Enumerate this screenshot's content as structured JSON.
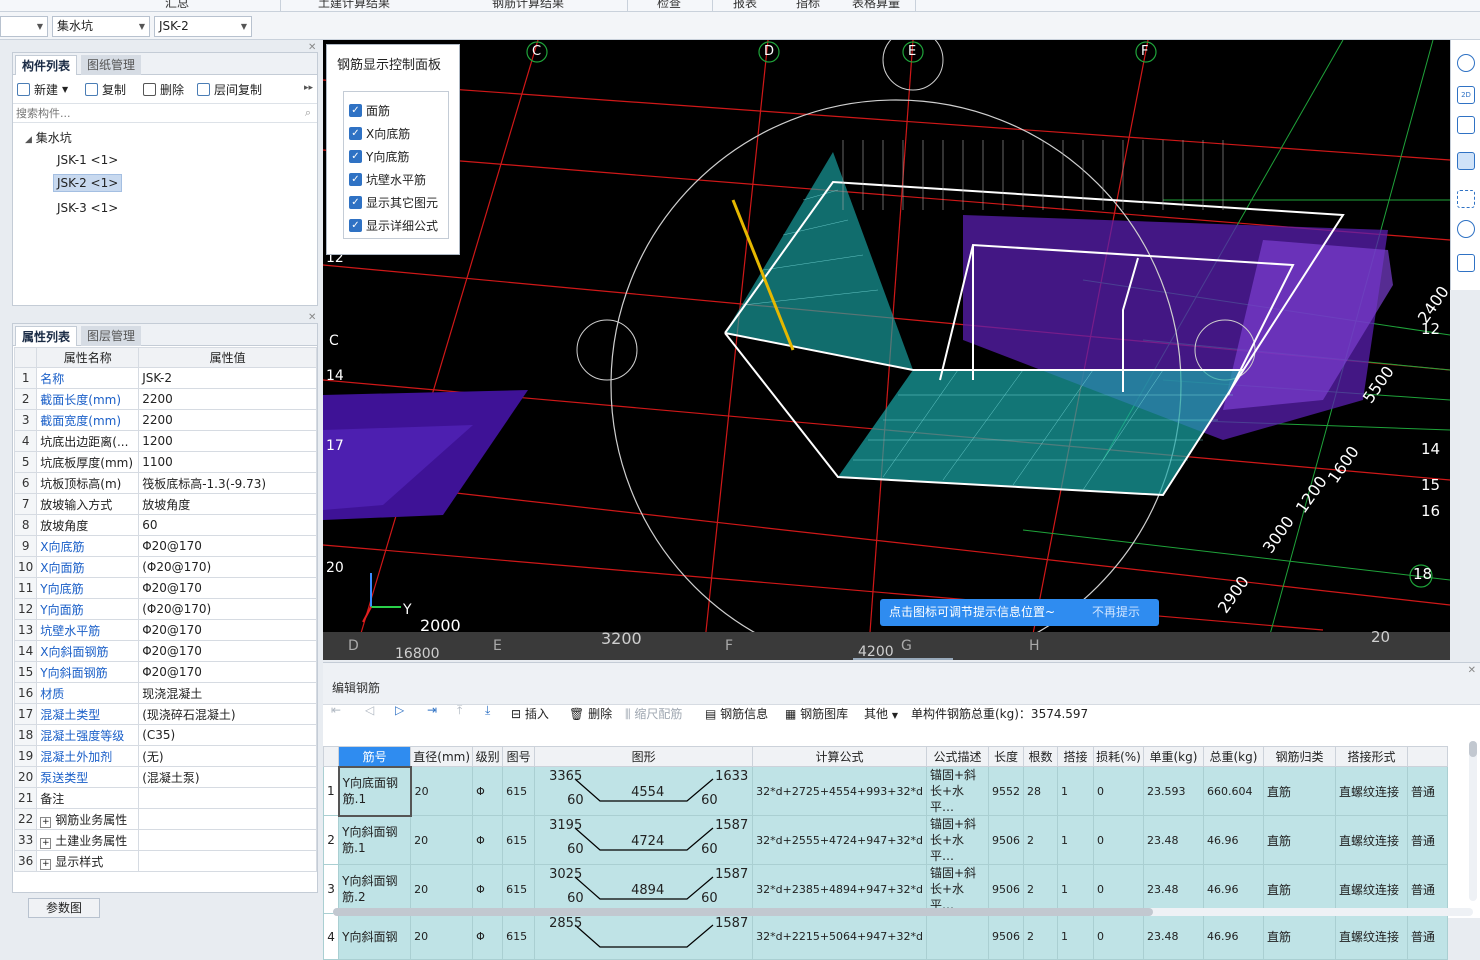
{
  "top_menu": [
    "汇总",
    "土建计算结果",
    "钢筋计算结果",
    "检查",
    "报表",
    "指标",
    "表格算量"
  ],
  "selectors": {
    "first": "",
    "category": "集水坑",
    "instance": "JSK-2"
  },
  "component_panel": {
    "tabs": [
      "构件列表",
      "图纸管理"
    ],
    "toolbar": [
      "新建",
      "复制",
      "删除",
      "层间复制"
    ],
    "search_placeholder": "搜索构件...",
    "root": "集水坑",
    "items": [
      "JSK-1 <1>",
      "JSK-2 <1>",
      "JSK-3 <1>"
    ]
  },
  "property_panel": {
    "tabs": [
      "属性列表",
      "图层管理"
    ],
    "header": [
      "属性名称",
      "属性值"
    ],
    "rows": [
      {
        "no": "1",
        "name": "名称",
        "value": "JSK-2",
        "blue": true
      },
      {
        "no": "2",
        "name": "截面长度(mm)",
        "value": "2200",
        "blue": true
      },
      {
        "no": "3",
        "name": "截面宽度(mm)",
        "value": "2200",
        "blue": true
      },
      {
        "no": "4",
        "name": "坑底出边距离(...",
        "value": "1200",
        "blue": false
      },
      {
        "no": "5",
        "name": "坑底板厚度(mm)",
        "value": "1100",
        "blue": false
      },
      {
        "no": "6",
        "name": "坑板顶标高(m)",
        "value": "筏板底标高-1.3(-9.73)",
        "blue": false
      },
      {
        "no": "7",
        "name": "放坡输入方式",
        "value": "放坡角度",
        "blue": false
      },
      {
        "no": "8",
        "name": "放坡角度",
        "value": "60",
        "blue": false
      },
      {
        "no": "9",
        "name": "X向底筋",
        "value": "Φ20@170",
        "blue": true
      },
      {
        "no": "10",
        "name": "X向面筋",
        "value": "(Φ20@170)",
        "blue": true
      },
      {
        "no": "11",
        "name": "Y向底筋",
        "value": "Φ20@170",
        "blue": true
      },
      {
        "no": "12",
        "name": "Y向面筋",
        "value": "(Φ20@170)",
        "blue": true
      },
      {
        "no": "13",
        "name": "坑壁水平筋",
        "value": "Φ20@170",
        "blue": true
      },
      {
        "no": "14",
        "name": "X向斜面钢筋",
        "value": "Φ20@170",
        "blue": true
      },
      {
        "no": "15",
        "name": "Y向斜面钢筋",
        "value": "Φ20@170",
        "blue": true
      },
      {
        "no": "16",
        "name": "材质",
        "value": "现浇混凝土",
        "blue": true
      },
      {
        "no": "17",
        "name": "混凝土类型",
        "value": "(现浇碎石混凝土)",
        "blue": true
      },
      {
        "no": "18",
        "name": "混凝土强度等级",
        "value": "(C35)",
        "blue": true
      },
      {
        "no": "19",
        "name": "混凝土外加剂",
        "value": "(无)",
        "blue": true
      },
      {
        "no": "20",
        "name": "泵送类型",
        "value": "(混凝土泵)",
        "blue": true
      },
      {
        "no": "21",
        "name": "备注",
        "value": "",
        "blue": false
      },
      {
        "no": "22",
        "name": "钢筋业务属性",
        "value": "",
        "blue": false,
        "group": true
      },
      {
        "no": "33",
        "name": "土建业务属性",
        "value": "",
        "blue": false,
        "group": true
      },
      {
        "no": "36",
        "name": "显示样式",
        "value": "",
        "blue": false,
        "group": true
      }
    ],
    "params_button": "参数图"
  },
  "control_panel": {
    "title": "钢筋显示控制面板",
    "options": [
      "面筋",
      "X向底筋",
      "Y向底筋",
      "坑壁水平筋",
      "显示其它图元",
      "显示详细公式"
    ]
  },
  "viewport": {
    "axis_letters": [
      "C",
      "D",
      "E",
      "F"
    ],
    "left_labels": [
      "12",
      "C",
      "14",
      "17",
      "20"
    ],
    "right_labels": [
      "12",
      "14",
      "15",
      "16",
      "18"
    ],
    "dims": [
      "2400",
      "5500",
      "1600",
      "1200",
      "3000",
      "2900",
      "2000",
      "3200",
      "16800",
      "4200",
      "20"
    ],
    "bottom_letters": [
      "D",
      "E",
      "F",
      "G",
      "H"
    ],
    "axis_y": "Y",
    "tip_text": "点击图标可调节提示信息位置~",
    "tip_dismiss": "不再提示"
  },
  "edit_rebar": {
    "title": "编辑钢筋",
    "toolbar": [
      "插入",
      "删除",
      "缩尺配筋",
      "钢筋信息",
      "钢筋图库",
      "其他"
    ],
    "total_label": "单构件钢筋总重(kg)：3574.597",
    "columns": [
      "筋号",
      "直径(mm)",
      "级别",
      "图号",
      "图形",
      "计算公式",
      "公式描述",
      "长度",
      "根数",
      "搭接",
      "损耗(%)",
      "单重(kg)",
      "总重(kg)",
      "钢筋归类",
      "搭接形式",
      ""
    ],
    "rows": [
      {
        "no": "1",
        "name": "Y向底面钢筋.1",
        "dia": "20",
        "grade": "Φ",
        "fig": "615",
        "shape": {
          "top_left": "3365",
          "bot_left": "60",
          "mid": "4554",
          "top_right": "1633",
          "bot_right": "60"
        },
        "formula": "32*d+2725+4554+993+32*d",
        "desc": "锚固+斜长+水平…",
        "len": "9552",
        "count": "28",
        "lap": "1",
        "loss": "0",
        "unit": "23.593",
        "total": "660.604",
        "type": "直筋",
        "lap_form": "直螺纹连接",
        "extra": "普通"
      },
      {
        "no": "2",
        "name": "Y向斜面钢筋.1",
        "dia": "20",
        "grade": "Φ",
        "fig": "615",
        "shape": {
          "top_left": "3195",
          "bot_left": "60",
          "mid": "4724",
          "top_right": "1587",
          "bot_right": "60"
        },
        "formula": "32*d+2555+4724+947+32*d",
        "desc": "锚固+斜长+水平…",
        "len": "9506",
        "count": "2",
        "lap": "1",
        "loss": "0",
        "unit": "23.48",
        "total": "46.96",
        "type": "直筋",
        "lap_form": "直螺纹连接",
        "extra": "普通"
      },
      {
        "no": "3",
        "name": "Y向斜面钢筋.2",
        "dia": "20",
        "grade": "Φ",
        "fig": "615",
        "shape": {
          "top_left": "3025",
          "bot_left": "60",
          "mid": "4894",
          "top_right": "1587",
          "bot_right": "60"
        },
        "formula": "32*d+2385+4894+947+32*d",
        "desc": "锚固+斜长+水平…",
        "len": "9506",
        "count": "2",
        "lap": "1",
        "loss": "0",
        "unit": "23.48",
        "total": "46.96",
        "type": "直筋",
        "lap_form": "直螺纹连接",
        "extra": "普通"
      },
      {
        "no": "4",
        "name": "Y向斜面钢",
        "dia": "20",
        "grade": "Φ",
        "fig": "615",
        "shape": {
          "top_left": "2855",
          "bot_left": "",
          "mid": "",
          "top_right": "1587",
          "bot_right": ""
        },
        "formula": "32*d+2215+5064+947+32*d",
        "desc": "",
        "len": "9506",
        "count": "2",
        "lap": "1",
        "loss": "0",
        "unit": "23.48",
        "total": "46.96",
        "type": "直筋",
        "lap_form": "直螺纹连接",
        "extra": "普通"
      }
    ]
  }
}
